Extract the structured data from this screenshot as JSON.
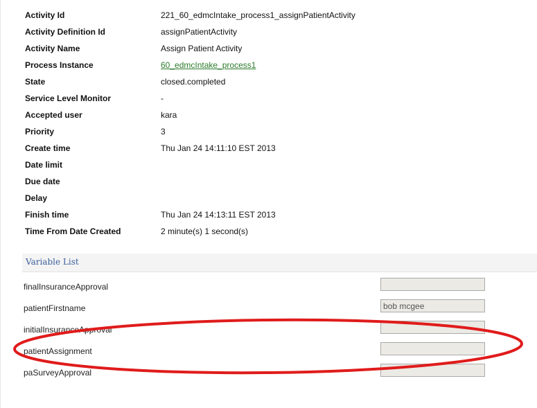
{
  "properties": [
    {
      "label": "Activity Id",
      "value": "221_60_edmcIntake_process1_assignPatientActivity"
    },
    {
      "label": "Activity Definition Id",
      "value": "assignPatientActivity"
    },
    {
      "label": "Activity Name",
      "value": "Assign Patient Activity"
    },
    {
      "label": "Process Instance",
      "value": "60_edmcIntake_process1",
      "link": true
    },
    {
      "label": "State",
      "value": "closed.completed"
    },
    {
      "label": "Service Level Monitor",
      "value": "-"
    },
    {
      "label": "Accepted user",
      "value": "kara"
    },
    {
      "label": "Priority",
      "value": "3"
    },
    {
      "label": "Create time",
      "value": "Thu Jan 24 14:11:10 EST 2013"
    },
    {
      "label": "Date limit",
      "value": ""
    },
    {
      "label": "Due date",
      "value": ""
    },
    {
      "label": "Delay",
      "value": ""
    },
    {
      "label": "Finish time",
      "value": "Thu Jan 24 14:13:11 EST 2013"
    },
    {
      "label": "Time From Date Created",
      "value": "2 minute(s) 1 second(s)"
    }
  ],
  "variable_list": {
    "title": "Variable List",
    "items": [
      {
        "name": "finalInsuranceApproval",
        "value": ""
      },
      {
        "name": "patientFirstname",
        "value": "bob mcgee"
      },
      {
        "name": "initialInsuranceApproval",
        "value": ""
      },
      {
        "name": "patientAssignment",
        "value": ""
      },
      {
        "name": "paSurveyApproval",
        "value": ""
      }
    ]
  },
  "colors": {
    "link": "#2b7a2b",
    "section_title": "#3a5f9a",
    "annotation": "#e01b1b",
    "input_bg": "#ebeae4"
  }
}
